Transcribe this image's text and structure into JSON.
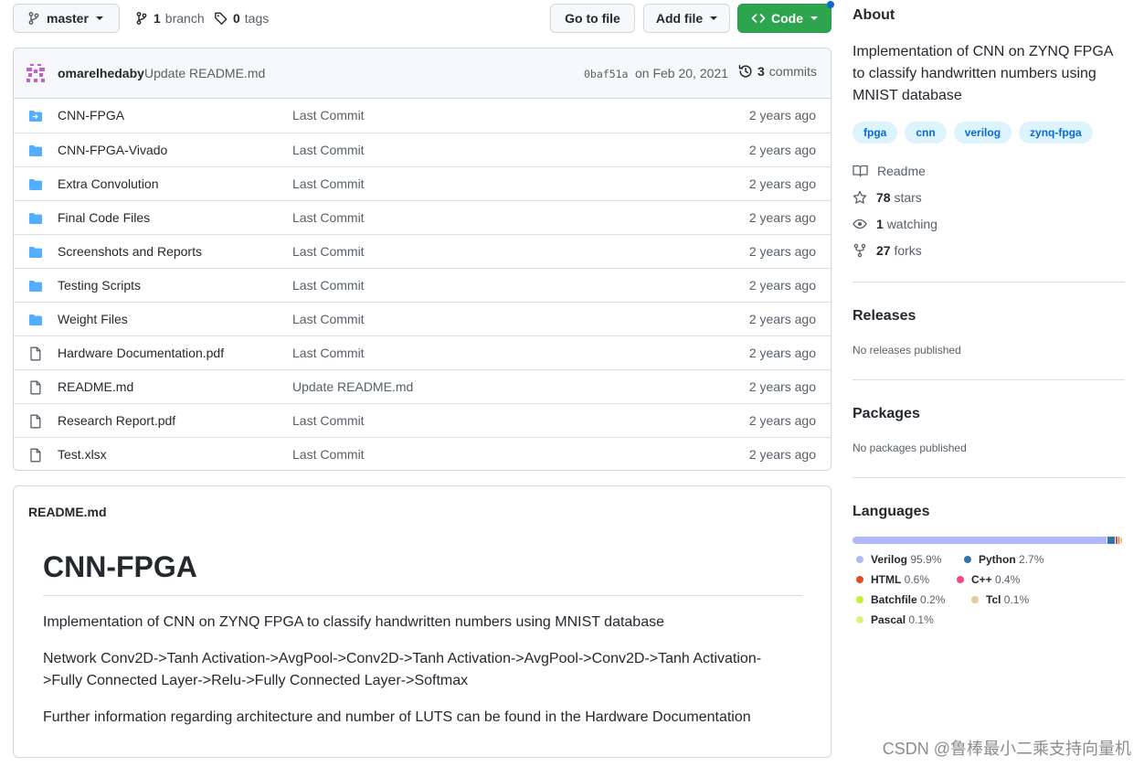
{
  "toolbar": {
    "branch": "master",
    "branches_count": "1",
    "branches_label": "branch",
    "tags_count": "0",
    "tags_label": "tags",
    "go_to_file": "Go to file",
    "add_file": "Add file",
    "code": "Code"
  },
  "latest_commit": {
    "author": "omarelhedaby",
    "message": "Update README.md",
    "sha": "0baf51a",
    "date": "on Feb 20, 2021",
    "commits_count": "3",
    "commits_label": "commits"
  },
  "files": [
    {
      "type": "submodule",
      "icon": "submodule-folder-icon",
      "name": "CNN-FPGA",
      "message": "Last Commit",
      "age": "2 years ago"
    },
    {
      "type": "dir",
      "icon": "folder-icon",
      "name": "CNN-FPGA-Vivado",
      "message": "Last Commit",
      "age": "2 years ago"
    },
    {
      "type": "dir",
      "icon": "folder-icon",
      "name": "Extra Convolution",
      "message": "Last Commit",
      "age": "2 years ago"
    },
    {
      "type": "dir",
      "icon": "folder-icon",
      "name": "Final Code Files",
      "message": "Last Commit",
      "age": "2 years ago"
    },
    {
      "type": "dir",
      "icon": "folder-icon",
      "name": "Screenshots and Reports",
      "message": "Last Commit",
      "age": "2 years ago"
    },
    {
      "type": "dir",
      "icon": "folder-icon",
      "name": "Testing Scripts",
      "message": "Last Commit",
      "age": "2 years ago"
    },
    {
      "type": "dir",
      "icon": "folder-icon",
      "name": "Weight Files",
      "message": "Last Commit",
      "age": "2 years ago"
    },
    {
      "type": "file",
      "icon": "file-icon",
      "name": "Hardware Documentation.pdf",
      "message": "Last Commit",
      "age": "2 years ago"
    },
    {
      "type": "file",
      "icon": "file-icon",
      "name": "README.md",
      "message": "Update README.md",
      "age": "2 years ago"
    },
    {
      "type": "file",
      "icon": "file-icon",
      "name": "Research Report.pdf",
      "message": "Last Commit",
      "age": "2 years ago"
    },
    {
      "type": "file",
      "icon": "file-icon",
      "name": "Test.xlsx",
      "message": "Last Commit",
      "age": "2 years ago"
    }
  ],
  "readme": {
    "label": "README.md",
    "heading": "CNN-FPGA",
    "p1": "Implementation of CNN on ZYNQ FPGA to classify handwritten numbers using MNIST database",
    "p2": "Network Conv2D->Tanh Activation->AvgPool->Conv2D->Tanh Activation->AvgPool->Conv2D->Tanh Activation->Fully Connected Layer->Relu->Fully Connected Layer->Softmax",
    "p3": "Further information regarding architecture and number of LUTS can be found in the Hardware Documentation"
  },
  "sidebar": {
    "about_title": "About",
    "description": "Implementation of CNN on ZYNQ FPGA to classify handwritten numbers using MNIST database",
    "topics": [
      "fpga",
      "cnn",
      "verilog",
      "zynq-fpga"
    ],
    "readme_label": "Readme",
    "stars_count": "78",
    "stars_label": "stars",
    "watching_count": "1",
    "watching_label": "watching",
    "forks_count": "27",
    "forks_label": "forks",
    "releases_title": "Releases",
    "releases_text": "No releases published",
    "packages_title": "Packages",
    "packages_text": "No packages published",
    "languages_title": "Languages",
    "languages": [
      {
        "name": "Verilog",
        "percent": "95.9%",
        "value": 95.9,
        "color": "#b2b7f8"
      },
      {
        "name": "Python",
        "percent": "2.7%",
        "value": 2.7,
        "color": "#3572a5"
      },
      {
        "name": "HTML",
        "percent": "0.6%",
        "value": 0.6,
        "color": "#e34c26"
      },
      {
        "name": "C++",
        "percent": "0.4%",
        "value": 0.4,
        "color": "#f34b7d"
      },
      {
        "name": "Batchfile",
        "percent": "0.2%",
        "value": 0.2,
        "color": "#c1f12e"
      },
      {
        "name": "Tcl",
        "percent": "0.1%",
        "value": 0.1,
        "color": "#e4cc98"
      },
      {
        "name": "Pascal",
        "percent": "0.1%",
        "value": 0.1,
        "color": "#e3f171"
      }
    ]
  },
  "watermark": "CSDN @鲁棒最小二乘支持向量机",
  "colors": {
    "primary_button": "#2da44e",
    "link": "#0969da",
    "folder": "#54aeff",
    "text_muted": "#57606a"
  }
}
